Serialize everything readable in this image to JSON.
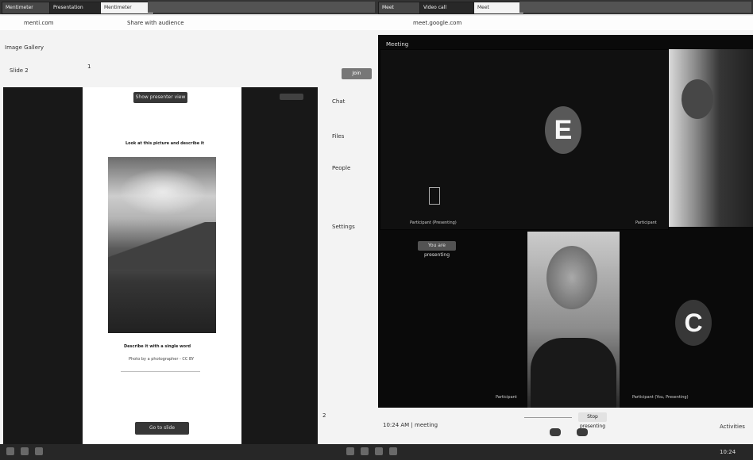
{
  "left_window": {
    "tabs": [
      "Mentimeter",
      "Presentation",
      "Mentimeter"
    ],
    "toolbar_text": "Share with audience",
    "subtitle": "Image Gallery",
    "address": "menti.com",
    "slide_tag": "Slide 2",
    "present_label": "Show presenter view",
    "slide_heading": "Look at this picture and describe it",
    "caption_line1": "Describe it with a single word",
    "caption_line2": "Photo by a photographer - CC BY",
    "next_button": "Go to slide",
    "side_numbers": [
      "1",
      "2"
    ]
  },
  "right_window": {
    "tabs": [
      "Meet",
      "Video call",
      "Meet"
    ],
    "toolbar_text": "meet.google.com",
    "left_panel_items": [
      "Chat",
      "Files",
      "People",
      "Settings"
    ],
    "join_button": "Join",
    "meeting_name": "Meeting",
    "participants": [
      {
        "initial": "E",
        "name": "Participant (Presenting)"
      },
      {
        "initial": "",
        "name": "Participant"
      },
      {
        "initial": "",
        "name": "Participant"
      },
      {
        "initial": "C",
        "name": "Participant (You, Presenting)"
      }
    ],
    "present_pill": "You are presenting",
    "stop_button": "Stop presenting",
    "bottom_left": "10:24 AM | meeting",
    "bottom_right": "Activities"
  },
  "taskbar": {
    "icons": [
      "start-icon",
      "search-icon",
      "taskview-icon",
      "explorer-icon",
      "browser-icon",
      "mail-icon",
      "camera-icon"
    ],
    "clock": "10:24"
  }
}
